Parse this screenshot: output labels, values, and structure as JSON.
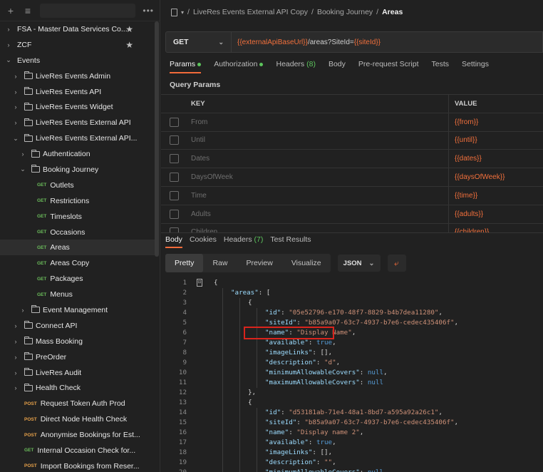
{
  "sidebar": {
    "items": [
      {
        "chev": "›",
        "type": "root",
        "label": "FSA - Master Data Services Co...",
        "star": true
      },
      {
        "chev": "›",
        "type": "root",
        "label": "ZCF",
        "star": true
      },
      {
        "chev": "⌄",
        "type": "root",
        "label": "Events",
        "star": false
      },
      {
        "chev": "›",
        "type": "folder",
        "indent": 1,
        "label": "LiveRes Events Admin"
      },
      {
        "chev": "›",
        "type": "folder",
        "indent": 1,
        "label": "LiveRes Events API"
      },
      {
        "chev": "›",
        "type": "folder",
        "indent": 1,
        "label": "LiveRes Events Widget"
      },
      {
        "chev": "›",
        "type": "folder",
        "indent": 1,
        "label": "LiveRes Events External API"
      },
      {
        "chev": "⌄",
        "type": "folder",
        "indent": 1,
        "label": "LiveRes Events External API..."
      },
      {
        "chev": "›",
        "type": "folder",
        "indent": 2,
        "label": "Authentication"
      },
      {
        "chev": "⌄",
        "type": "folder",
        "indent": 2,
        "label": "Booking Journey"
      },
      {
        "type": "request",
        "method": "GET",
        "indent": 3,
        "label": "Outlets"
      },
      {
        "type": "request",
        "method": "GET",
        "indent": 3,
        "label": "Restrictions"
      },
      {
        "type": "request",
        "method": "GET",
        "indent": 3,
        "label": "Timeslots"
      },
      {
        "type": "request",
        "method": "GET",
        "indent": 3,
        "label": "Occasions"
      },
      {
        "type": "request",
        "method": "GET",
        "indent": 3,
        "label": "Areas",
        "selected": true
      },
      {
        "type": "request",
        "method": "GET",
        "indent": 3,
        "label": "Areas Copy"
      },
      {
        "type": "request",
        "method": "GET",
        "indent": 3,
        "label": "Packages"
      },
      {
        "type": "request",
        "method": "GET",
        "indent": 3,
        "label": "Menus"
      },
      {
        "chev": "›",
        "type": "folder",
        "indent": 2,
        "label": "Event Management"
      },
      {
        "chev": "›",
        "type": "folder",
        "indent": 1,
        "label": "Connect API"
      },
      {
        "chev": "›",
        "type": "folder",
        "indent": 1,
        "label": "Mass Booking"
      },
      {
        "chev": "›",
        "type": "folder",
        "indent": 1,
        "label": "PreOrder"
      },
      {
        "chev": "›",
        "type": "folder",
        "indent": 1,
        "label": "LiveRes Audit"
      },
      {
        "chev": "›",
        "type": "folder",
        "indent": 1,
        "label": "Health Check"
      },
      {
        "type": "request",
        "method": "POST",
        "indent": 1.5,
        "label": "Request Token Auth Prod"
      },
      {
        "type": "request",
        "method": "POST",
        "indent": 1.5,
        "label": "Direct Node Health Check"
      },
      {
        "type": "request",
        "method": "POST",
        "indent": 1.5,
        "label": "Anonymise Bookings for Est..."
      },
      {
        "type": "request",
        "method": "GET",
        "indent": 1.5,
        "label": "Internal Occasion Check for..."
      },
      {
        "type": "request",
        "method": "POST",
        "indent": 1.5,
        "label": "Import Bookings from Reser..."
      }
    ]
  },
  "breadcrumb": {
    "sep": "/",
    "collection": "LiveRes Events External API Copy",
    "folder": "Booking Journey",
    "current": "Areas"
  },
  "request": {
    "method": "GET",
    "url_var1": "{{externalApiBaseUrl}}",
    "url_path": "/areas?SiteId=",
    "url_var2": "{{siteId}}"
  },
  "req_tabs": {
    "params": "Params",
    "authorization": "Authorization",
    "headers": "Headers",
    "headers_count": "(8)",
    "body": "Body",
    "prerequest": "Pre-request Script",
    "tests": "Tests",
    "settings": "Settings"
  },
  "query_params": {
    "title": "Query Params",
    "key_header": "KEY",
    "value_header": "VALUE",
    "rows": [
      {
        "key": "From",
        "value": "{{from}}"
      },
      {
        "key": "Until",
        "value": "{{until}}"
      },
      {
        "key": "Dates",
        "value": "{{dates}}"
      },
      {
        "key": "DaysOfWeek",
        "value": "{{daysOfWeek}}"
      },
      {
        "key": "Time",
        "value": "{{time}}"
      },
      {
        "key": "Adults",
        "value": "{{adults}}"
      },
      {
        "key": "Children",
        "value": "{{children}}"
      }
    ]
  },
  "resp_tabs": {
    "body": "Body",
    "cookies": "Cookies",
    "headers": "Headers",
    "headers_count": "(7)",
    "test_results": "Test Results"
  },
  "resp_tools": {
    "views": [
      "Pretty",
      "Raw",
      "Preview",
      "Visualize"
    ],
    "format": "JSON"
  },
  "code_lines": [
    {
      "n": "1",
      "indent": 0,
      "parts": [
        [
          "p",
          "{"
        ]
      ]
    },
    {
      "n": "2",
      "indent": 1,
      "parts": [
        [
          "k",
          "\"areas\""
        ],
        [
          "p",
          ": ["
        ]
      ]
    },
    {
      "n": "3",
      "indent": 2,
      "parts": [
        [
          "p",
          "{"
        ]
      ]
    },
    {
      "n": "4",
      "indent": 3,
      "parts": [
        [
          "k",
          "\"id\""
        ],
        [
          "p",
          ": "
        ],
        [
          "s",
          "\"05e52796-e170-48f7-8829-b4b7dea11280\""
        ],
        [
          "p",
          ","
        ]
      ]
    },
    {
      "n": "5",
      "indent": 3,
      "parts": [
        [
          "k",
          "\"siteId\""
        ],
        [
          "p",
          ": "
        ],
        [
          "s",
          "\"b85a9a07-63c7-4937-b7e6-cedec435406f\""
        ],
        [
          "p",
          ","
        ]
      ]
    },
    {
      "n": "6",
      "indent": 3,
      "parts": [
        [
          "k",
          "\"name\""
        ],
        [
          "p",
          ": "
        ],
        [
          "s",
          "\"Display Name\""
        ],
        [
          "p",
          ","
        ]
      ]
    },
    {
      "n": "7",
      "indent": 3,
      "parts": [
        [
          "k",
          "\"available\""
        ],
        [
          "p",
          ": "
        ],
        [
          "kw",
          "true"
        ],
        [
          "p",
          ","
        ]
      ]
    },
    {
      "n": "8",
      "indent": 3,
      "parts": [
        [
          "k",
          "\"imageLinks\""
        ],
        [
          "p",
          ": [],"
        ]
      ]
    },
    {
      "n": "9",
      "indent": 3,
      "parts": [
        [
          "k",
          "\"description\""
        ],
        [
          "p",
          ": "
        ],
        [
          "s",
          "\"d\""
        ],
        [
          "p",
          ","
        ]
      ]
    },
    {
      "n": "10",
      "indent": 3,
      "parts": [
        [
          "k",
          "\"minimumAllowableCovers\""
        ],
        [
          "p",
          ": "
        ],
        [
          "kw",
          "null"
        ],
        [
          "p",
          ","
        ]
      ]
    },
    {
      "n": "11",
      "indent": 3,
      "parts": [
        [
          "k",
          "\"maximumAllowableCovers\""
        ],
        [
          "p",
          ": "
        ],
        [
          "kw",
          "null"
        ]
      ]
    },
    {
      "n": "12",
      "indent": 2,
      "parts": [
        [
          "p",
          "},"
        ]
      ]
    },
    {
      "n": "13",
      "indent": 2,
      "parts": [
        [
          "p",
          "{"
        ]
      ]
    },
    {
      "n": "14",
      "indent": 3,
      "parts": [
        [
          "k",
          "\"id\""
        ],
        [
          "p",
          ": "
        ],
        [
          "s",
          "\"d53181ab-71e4-48a1-8bd7-a595a92a26c1\""
        ],
        [
          "p",
          ","
        ]
      ]
    },
    {
      "n": "15",
      "indent": 3,
      "parts": [
        [
          "k",
          "\"siteId\""
        ],
        [
          "p",
          ": "
        ],
        [
          "s",
          "\"b85a9a07-63c7-4937-b7e6-cedec435406f\""
        ],
        [
          "p",
          ","
        ]
      ]
    },
    {
      "n": "16",
      "indent": 3,
      "parts": [
        [
          "k",
          "\"name\""
        ],
        [
          "p",
          ": "
        ],
        [
          "s",
          "\"Display name 2\""
        ],
        [
          "p",
          ","
        ]
      ]
    },
    {
      "n": "17",
      "indent": 3,
      "parts": [
        [
          "k",
          "\"available\""
        ],
        [
          "p",
          ": "
        ],
        [
          "kw",
          "true"
        ],
        [
          "p",
          ","
        ]
      ]
    },
    {
      "n": "18",
      "indent": 3,
      "parts": [
        [
          "k",
          "\"imageLinks\""
        ],
        [
          "p",
          ": [],"
        ]
      ]
    },
    {
      "n": "19",
      "indent": 3,
      "parts": [
        [
          "k",
          "\"description\""
        ],
        [
          "p",
          ": "
        ],
        [
          "s",
          "\"\""
        ],
        [
          "p",
          ","
        ]
      ]
    },
    {
      "n": "20",
      "indent": 3,
      "parts": [
        [
          "k",
          "\"minimumAllowableCovers\""
        ],
        [
          "p",
          ": "
        ],
        [
          "kw",
          "null"
        ],
        [
          "p",
          ","
        ]
      ]
    }
  ],
  "colors": {
    "accent": "#f26b3a",
    "get": "#6bbd5b",
    "post": "#e8a24a",
    "highlight_box": "#d9241c"
  },
  "icons": [
    "plus-icon",
    "filter-icon",
    "more-icon",
    "chevron-icon",
    "folder-icon",
    "star-icon",
    "request-doc-icon",
    "wrap-lines-icon"
  ]
}
